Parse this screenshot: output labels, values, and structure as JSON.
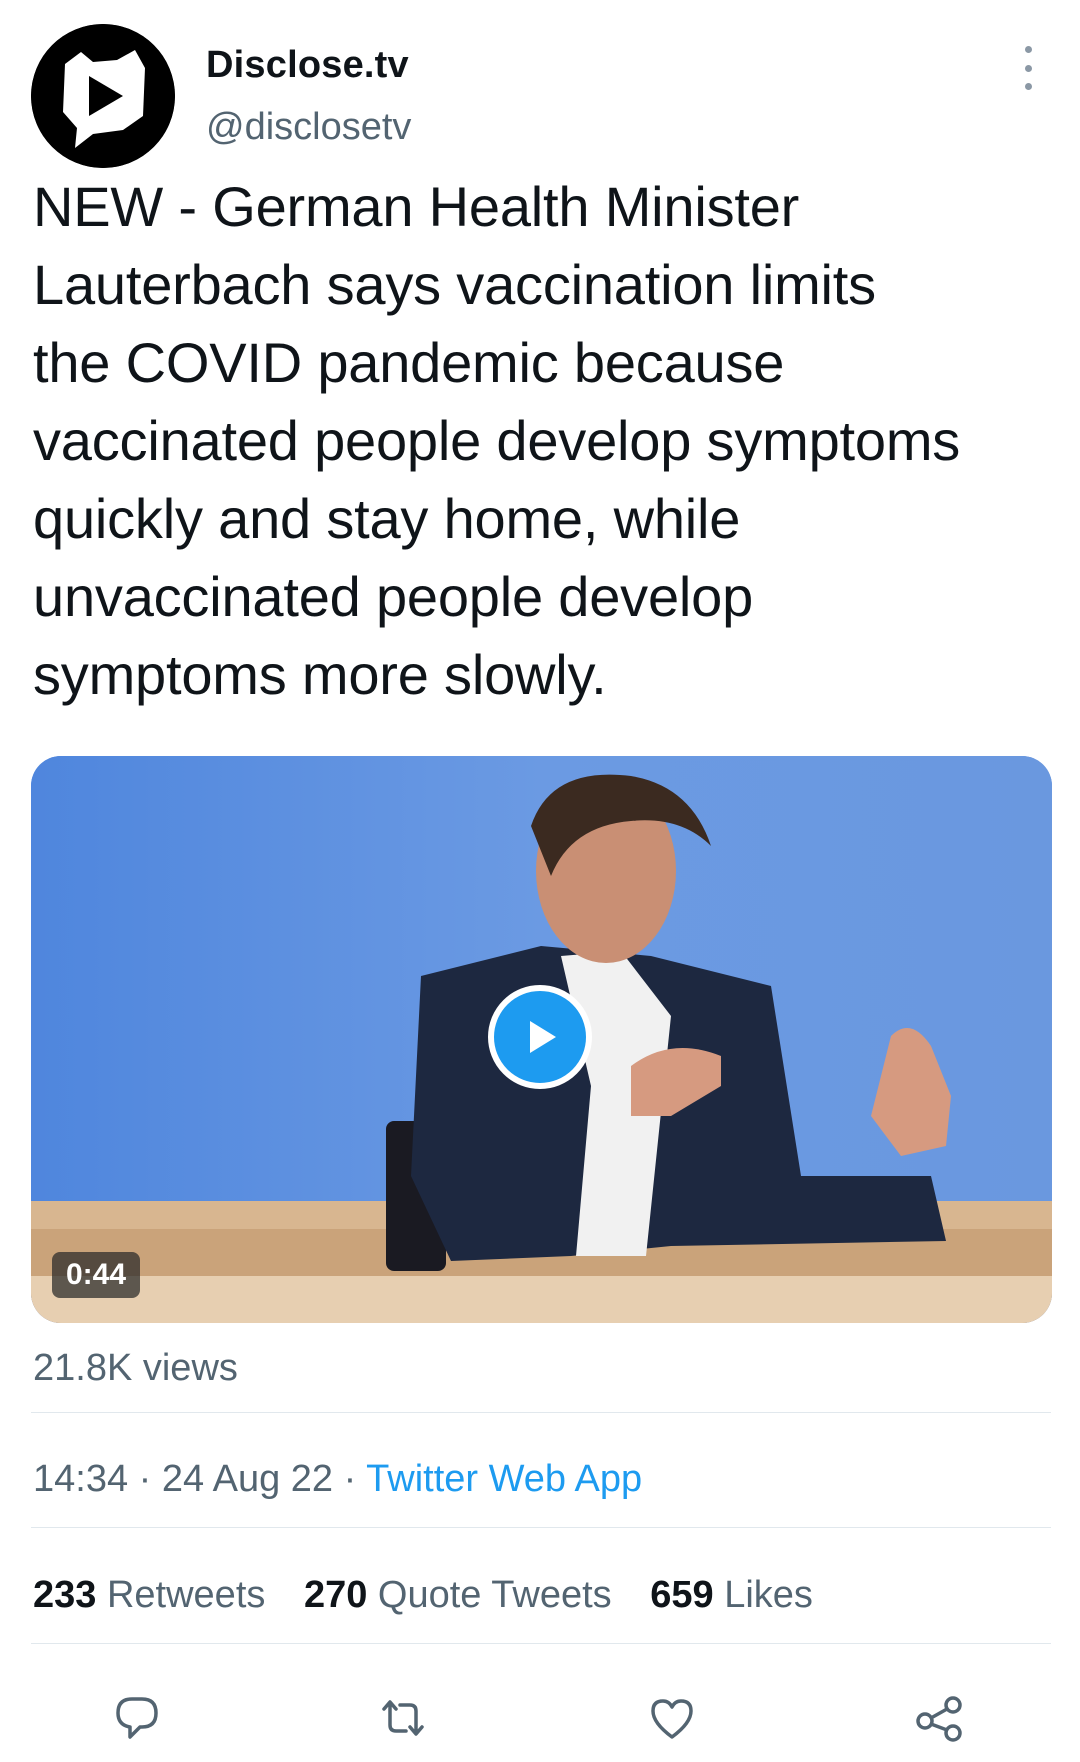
{
  "author": {
    "display_name": "Disclose.tv",
    "handle": "@disclosetv",
    "avatar_icon": "disclose-tv-logo"
  },
  "tweet": {
    "text": "NEW - German Health Minister\nLauterbach says vaccination limits\nthe COVID pandemic because\nvaccinated people develop symptoms\nquickly and stay home, while\nunvaccinated people develop\nsymptoms more slowly."
  },
  "media": {
    "duration": "0:44",
    "play_icon": "play-icon"
  },
  "views": "21.8K views",
  "meta": {
    "time": "14:34",
    "separator": " · ",
    "date": "24 Aug 22",
    "source": "Twitter Web App"
  },
  "stats": {
    "retweets_count": "233",
    "retweets_label": "Retweets",
    "quotes_count": "270",
    "quotes_label": "Quote Tweets",
    "likes_count": "659",
    "likes_label": "Likes"
  },
  "actions": [
    "reply-icon",
    "retweet-icon",
    "like-icon",
    "share-icon"
  ],
  "colors": {
    "accent": "#1d9bf0",
    "text_primary": "#0f1419",
    "text_secondary": "#536471",
    "divider": "#e1e8ed"
  }
}
